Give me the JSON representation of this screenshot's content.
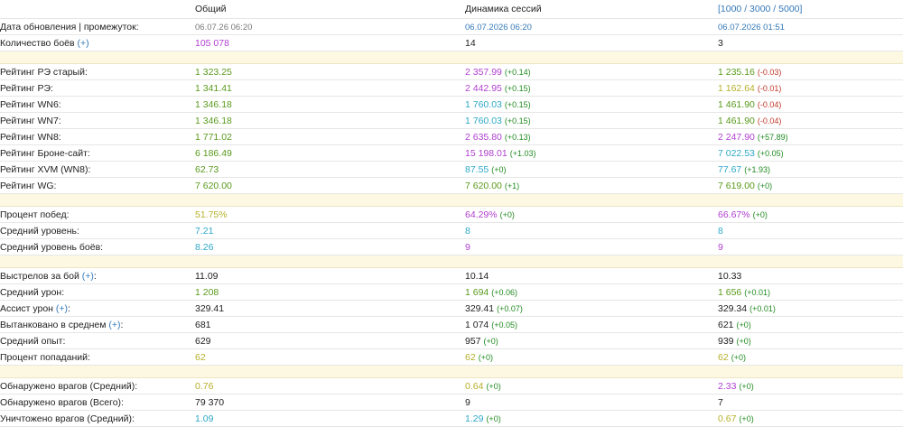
{
  "colors": {
    "default": "#222222",
    "green": "#5a9a1c",
    "purple": "#b03fcf",
    "cyan": "#2da8c8",
    "olive": "#b6b02a",
    "blue": "#3378b8",
    "delta_pos": "#228b22",
    "delta_neg": "#c0392b",
    "date": "#777777",
    "spacer_bg": "#fdf8e2"
  },
  "header": {
    "col_total": "Общий",
    "col_dynamics": "Динамика сессий",
    "col_ranges": "[1000 / 3000 / 5000]"
  },
  "rows": [
    {
      "type": "row",
      "label": "Дата обновления | промежуток:",
      "label_plus": "",
      "c1": {
        "v": "06.07.26 06:20",
        "color": "date",
        "small": true
      },
      "c2": {
        "v": "06.07.2026 06:20",
        "color": "blue",
        "small": true
      },
      "c3": {
        "v": "06.07.2026 01:51",
        "color": "blue",
        "small": true
      }
    },
    {
      "type": "row",
      "label": "Количество боёв",
      "label_plus": "(+)",
      "c1": {
        "v": "105 078",
        "color": "purple"
      },
      "c2": {
        "v": "14",
        "color": "default"
      },
      "c3": {
        "v": "3",
        "color": "default"
      }
    },
    {
      "type": "spacer"
    },
    {
      "type": "row",
      "label": "Рейтинг РЭ старый:",
      "label_plus": "",
      "c1": {
        "v": "1 323.25",
        "color": "green"
      },
      "c2": {
        "v": "2 357.99",
        "color": "purple",
        "d": "(+0.14)",
        "dc": "pos"
      },
      "c3": {
        "v": "1 235.16",
        "color": "green",
        "d": "(-0.03)",
        "dc": "neg"
      }
    },
    {
      "type": "row",
      "label": "Рейтинг РЭ:",
      "label_plus": "",
      "c1": {
        "v": "1 341.41",
        "color": "green"
      },
      "c2": {
        "v": "2 442.95",
        "color": "purple",
        "d": "(+0.15)",
        "dc": "pos"
      },
      "c3": {
        "v": "1 162.64",
        "color": "olive",
        "d": "(-0.01)",
        "dc": "neg"
      }
    },
    {
      "type": "row",
      "label": "Рейтинг WN6:",
      "label_plus": "",
      "c1": {
        "v": "1 346.18",
        "color": "green"
      },
      "c2": {
        "v": "1 760.03",
        "color": "cyan",
        "d": "(+0.15)",
        "dc": "pos"
      },
      "c3": {
        "v": "1 461.90",
        "color": "green",
        "d": "(-0.04)",
        "dc": "neg"
      }
    },
    {
      "type": "row",
      "label": "Рейтинг WN7:",
      "label_plus": "",
      "c1": {
        "v": "1 346.18",
        "color": "green"
      },
      "c2": {
        "v": "1 760.03",
        "color": "cyan",
        "d": "(+0.15)",
        "dc": "pos"
      },
      "c3": {
        "v": "1 461.90",
        "color": "green",
        "d": "(-0.04)",
        "dc": "neg"
      }
    },
    {
      "type": "row",
      "label": "Рейтинг WN8:",
      "label_plus": "",
      "c1": {
        "v": "1 771.02",
        "color": "green"
      },
      "c2": {
        "v": "2 635.80",
        "color": "purple",
        "d": "(+0.13)",
        "dc": "pos"
      },
      "c3": {
        "v": "2 247.90",
        "color": "purple",
        "d": "(+57.89)",
        "dc": "pos"
      }
    },
    {
      "type": "row",
      "label": "Рейтинг Броне-сайт:",
      "label_plus": "",
      "c1": {
        "v": "6 186.49",
        "color": "green"
      },
      "c2": {
        "v": "15 198.01",
        "color": "purple",
        "d": "(+1.03)",
        "dc": "pos"
      },
      "c3": {
        "v": "7 022.53",
        "color": "cyan",
        "d": "(+0.05)",
        "dc": "pos"
      }
    },
    {
      "type": "row",
      "label": "Рейтинг XVM (WN8):",
      "label_plus": "",
      "c1": {
        "v": "62.73",
        "color": "green"
      },
      "c2": {
        "v": "87.55",
        "color": "cyan",
        "d": "(+0)",
        "dc": "pos"
      },
      "c3": {
        "v": "77.67",
        "color": "cyan",
        "d": "(+1.93)",
        "dc": "pos"
      }
    },
    {
      "type": "row",
      "label": "Рейтинг WG:",
      "label_plus": "",
      "c1": {
        "v": "7 620.00",
        "color": "green"
      },
      "c2": {
        "v": "7 620.00",
        "color": "green",
        "d": "(+1)",
        "dc": "pos"
      },
      "c3": {
        "v": "7 619.00",
        "color": "green",
        "d": "(+0)",
        "dc": "pos"
      }
    },
    {
      "type": "spacer"
    },
    {
      "type": "row",
      "label": "Процент побед:",
      "label_plus": "",
      "c1": {
        "v": "51.75%",
        "color": "olive"
      },
      "c2": {
        "v": "64.29%",
        "color": "purple",
        "d": "(+0)",
        "dc": "pos"
      },
      "c3": {
        "v": "66.67%",
        "color": "purple",
        "d": "(+0)",
        "dc": "pos"
      }
    },
    {
      "type": "row",
      "label": "Средний уровень:",
      "label_plus": "",
      "c1": {
        "v": "7.21",
        "color": "cyan"
      },
      "c2": {
        "v": "8",
        "color": "cyan"
      },
      "c3": {
        "v": "8",
        "color": "cyan"
      }
    },
    {
      "type": "row",
      "label": "Средний уровень боёв:",
      "label_plus": "",
      "c1": {
        "v": "8.26",
        "color": "cyan"
      },
      "c2": {
        "v": "9",
        "color": "purple"
      },
      "c3": {
        "v": "9",
        "color": "purple"
      }
    },
    {
      "type": "spacer"
    },
    {
      "type": "row",
      "label": "Выстрелов за бой",
      "label_plus": "(+)",
      "label_end": ":",
      "c1": {
        "v": "11.09",
        "color": "default"
      },
      "c2": {
        "v": "10.14",
        "color": "default"
      },
      "c3": {
        "v": "10.33",
        "color": "default"
      }
    },
    {
      "type": "row",
      "label": "Средний урон:",
      "label_plus": "",
      "c1": {
        "v": "1 208",
        "color": "green"
      },
      "c2": {
        "v": "1 694",
        "color": "green",
        "d": "(+0.06)",
        "dc": "pos"
      },
      "c3": {
        "v": "1 656",
        "color": "green",
        "d": "(+0.01)",
        "dc": "pos"
      }
    },
    {
      "type": "row",
      "label": "Ассист урон",
      "label_plus": "(+)",
      "label_end": ":",
      "c1": {
        "v": "329.41",
        "color": "default"
      },
      "c2": {
        "v": "329.41",
        "color": "default",
        "d": "(+0.07)",
        "dc": "pos"
      },
      "c3": {
        "v": "329.34",
        "color": "default",
        "d": "(+0.01)",
        "dc": "pos"
      }
    },
    {
      "type": "row",
      "label": "Вытанковано в среднем",
      "label_plus": "(+)",
      "label_end": ":",
      "c1": {
        "v": "681",
        "color": "default"
      },
      "c2": {
        "v": "1 074",
        "color": "default",
        "d": "(+0.05)",
        "dc": "pos"
      },
      "c3": {
        "v": "621",
        "color": "default",
        "d": "(+0)",
        "dc": "pos"
      }
    },
    {
      "type": "row",
      "label": "Средний опыт:",
      "label_plus": "",
      "c1": {
        "v": "629",
        "color": "default"
      },
      "c2": {
        "v": "957",
        "color": "default",
        "d": "(+0)",
        "dc": "pos"
      },
      "c3": {
        "v": "939",
        "color": "default",
        "d": "(+0)",
        "dc": "pos"
      }
    },
    {
      "type": "row",
      "label": "Процент попаданий:",
      "label_plus": "",
      "c1": {
        "v": "62",
        "color": "olive"
      },
      "c2": {
        "v": "62",
        "color": "olive",
        "d": "(+0)",
        "dc": "pos"
      },
      "c3": {
        "v": "62",
        "color": "olive",
        "d": "(+0)",
        "dc": "pos"
      }
    },
    {
      "type": "spacer"
    },
    {
      "type": "row",
      "label": "Обнаружено врагов (Средний):",
      "label_plus": "",
      "c1": {
        "v": "0.76",
        "color": "olive"
      },
      "c2": {
        "v": "0.64",
        "color": "olive",
        "d": "(+0)",
        "dc": "pos"
      },
      "c3": {
        "v": "2.33",
        "color": "purple",
        "d": "(+0)",
        "dc": "pos"
      }
    },
    {
      "type": "row",
      "label": "Обнаружено врагов (Всего):",
      "label_plus": "",
      "c1": {
        "v": "79 370",
        "color": "default"
      },
      "c2": {
        "v": "9",
        "color": "default"
      },
      "c3": {
        "v": "7",
        "color": "default"
      }
    },
    {
      "type": "row",
      "label": "Уничтожено врагов (Средний):",
      "label_plus": "",
      "c1": {
        "v": "1.09",
        "color": "cyan"
      },
      "c2": {
        "v": "1.29",
        "color": "cyan",
        "d": "(+0)",
        "dc": "pos"
      },
      "c3": {
        "v": "0.67",
        "color": "olive",
        "d": "(+0)",
        "dc": "pos"
      }
    }
  ]
}
